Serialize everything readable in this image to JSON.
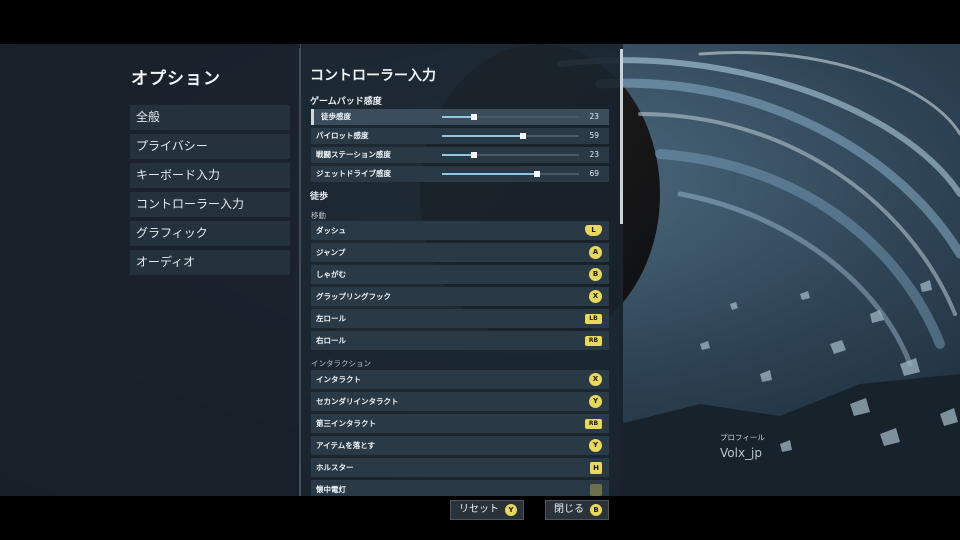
{
  "menu": {
    "title": "オプション",
    "items": [
      "全般",
      "プライバシー",
      "キーボード入力",
      "コントローラー入力",
      "グラフィック",
      "オーディオ"
    ]
  },
  "main": {
    "title": "コントローラー入力",
    "gamepad_section": "ゲームパッド感度",
    "sliders": [
      {
        "label": "徒歩感度",
        "value": "23",
        "fraction": 0.23
      },
      {
        "label": "パイロット感度",
        "value": "59",
        "fraction": 0.59
      },
      {
        "label": "戦闘ステーション感度",
        "value": "23",
        "fraction": 0.23
      },
      {
        "label": "ジェットドライブ感度",
        "value": "69",
        "fraction": 0.69
      }
    ],
    "walk_section": "徒歩",
    "move_sub": "移動",
    "move_binds": [
      {
        "label": "ダッシュ",
        "button": "L",
        "icon": "stick-click-icon"
      },
      {
        "label": "ジャンプ",
        "button": "A",
        "icon": "a-button-icon"
      },
      {
        "label": "しゃがむ",
        "button": "B",
        "icon": "b-button-icon"
      },
      {
        "label": "グラップリングフック",
        "button": "X",
        "icon": "x-button-icon"
      },
      {
        "label": "左ロール",
        "button": "LB",
        "icon": "lb-button-icon"
      },
      {
        "label": "右ロール",
        "button": "RB",
        "icon": "rb-button-icon"
      }
    ],
    "interact_sub": "インタラクション",
    "interact_binds": [
      {
        "label": "インタラクト",
        "button": "X",
        "icon": "x-button-icon"
      },
      {
        "label": "セカンダリインタラクト",
        "button": "Y",
        "icon": "y-button-icon"
      },
      {
        "label": "第三インタラクト",
        "button": "RB",
        "icon": "rb-button-icon"
      },
      {
        "label": "アイテムを落とす",
        "button": "Y",
        "icon": "y-button-icon"
      },
      {
        "label": "ホルスター",
        "button": "H",
        "icon": "dpad-button-icon"
      },
      {
        "label": "懐中電灯",
        "button": "",
        "icon": "dpad-button-icon"
      }
    ]
  },
  "profile": {
    "label": "プロフィール",
    "name": "Volx_jp"
  },
  "footer": {
    "reset_label": "リセット",
    "reset_button": "Y",
    "close_label": "閉じる",
    "close_button": "B"
  },
  "colors": {
    "accent_button": "#e8d95a",
    "slider_fill": "#8fc7e0",
    "panel": "#1a242c"
  }
}
